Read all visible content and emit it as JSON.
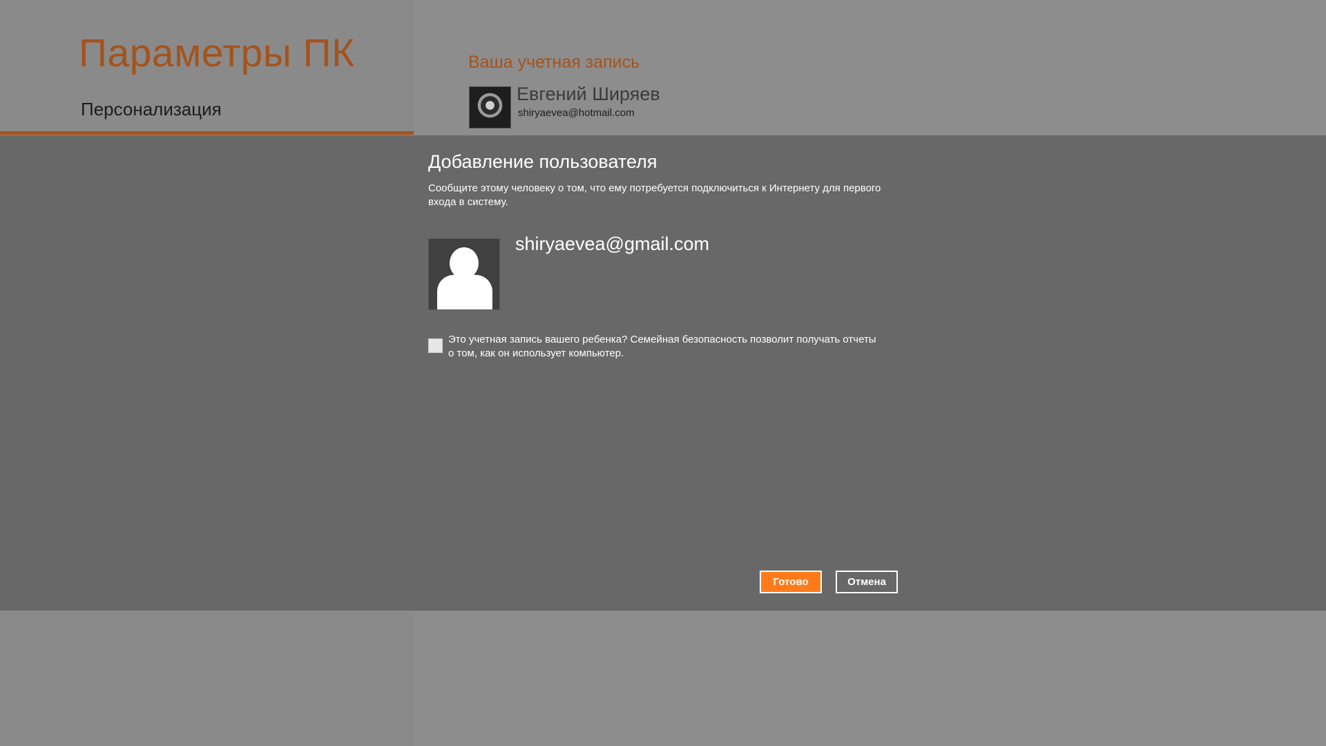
{
  "app": {
    "title": "Параметры ПК",
    "nav_items": [
      {
        "label": "Персонализация",
        "selected": true
      }
    ],
    "accent_color": "#a4531c"
  },
  "account": {
    "section_title": "Ваша учетная запись",
    "name": "Евгений Ширяев",
    "email": "shiryaevea@hotmail.com"
  },
  "dialog": {
    "title": "Добавление пользователя",
    "description": "Сообщите этому человеку о том, что ему потребуется подключиться к Интернету для первого входа в систему.",
    "new_user_email": "shiryaevea@gmail.com",
    "child_checkbox": {
      "checked": false,
      "label": "Это учетная запись вашего ребенка? Семейная безопасность позволит получать отчеты о том, как он использует компьютер."
    },
    "buttons": {
      "done": "Готово",
      "cancel": "Отмена"
    },
    "primary_button_color": "#ff7b1a"
  }
}
